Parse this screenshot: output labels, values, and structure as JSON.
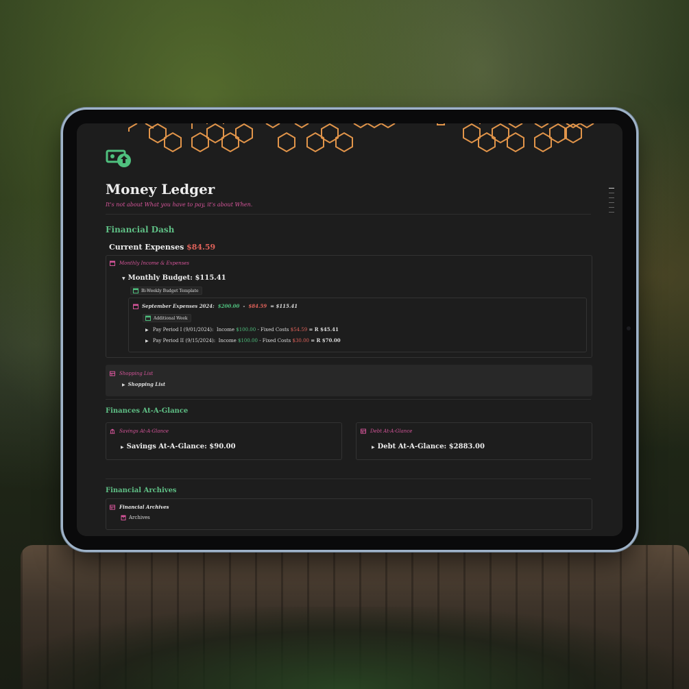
{
  "page": {
    "title": "Money Ledger",
    "subtitle": "It's not about What you have to pay, it's about When."
  },
  "colors": {
    "accent_green": "#5fbf85",
    "accent_pink": "#d6559a",
    "income_green": "#4fc07e",
    "expense_red": "#e0625a",
    "hex_orange": "#e2954a"
  },
  "icons": {
    "logo": "money-bill-icon",
    "calendar": "calendar-icon",
    "table": "table-icon",
    "bank": "bank-icon",
    "archive": "archive-icon"
  },
  "dash": {
    "heading": "Financial Dash",
    "current_expenses_label": "Current Expenses",
    "current_expenses_value": "$84.59",
    "income_expenses": {
      "label": "Monthly Income & Expenses",
      "budget_label": "Monthly Budget: $115.41",
      "template_chip": "Bi-Weekly Budget Template",
      "september": {
        "label": "September Expenses 2024:",
        "income": "$200.00",
        "minus": "-",
        "expenses": "$84.59",
        "equals": "= $115.41",
        "chip": "Additional Week",
        "periods": [
          {
            "label": "Pay Period I (9/01/2024):",
            "income_label": "Income",
            "income": "$100.00",
            "fixed_label": "- Fixed Costs",
            "fixed": "$54.59",
            "result": "= R $45.41"
          },
          {
            "label": "Pay Period II (9/15/2024):",
            "income_label": "Income",
            "income": "$100.00",
            "fixed_label": "- Fixed Costs",
            "fixed": "$30.00",
            "result": "= R $70.00"
          }
        ]
      }
    },
    "shopping": {
      "label": "Shopping List",
      "item": "Shopping List"
    }
  },
  "glance": {
    "heading": "Finances At-A-Glance",
    "savings": {
      "label": "Savings At-A-Glance",
      "value": "Savings At-A-Glance: $90.00"
    },
    "debt": {
      "label": "Debt At-A-Glance",
      "value": "Debt At-A-Glance: $2883.00"
    }
  },
  "archives": {
    "heading": "Financial Archives",
    "label": "Financial Archives",
    "item": "Archives"
  }
}
